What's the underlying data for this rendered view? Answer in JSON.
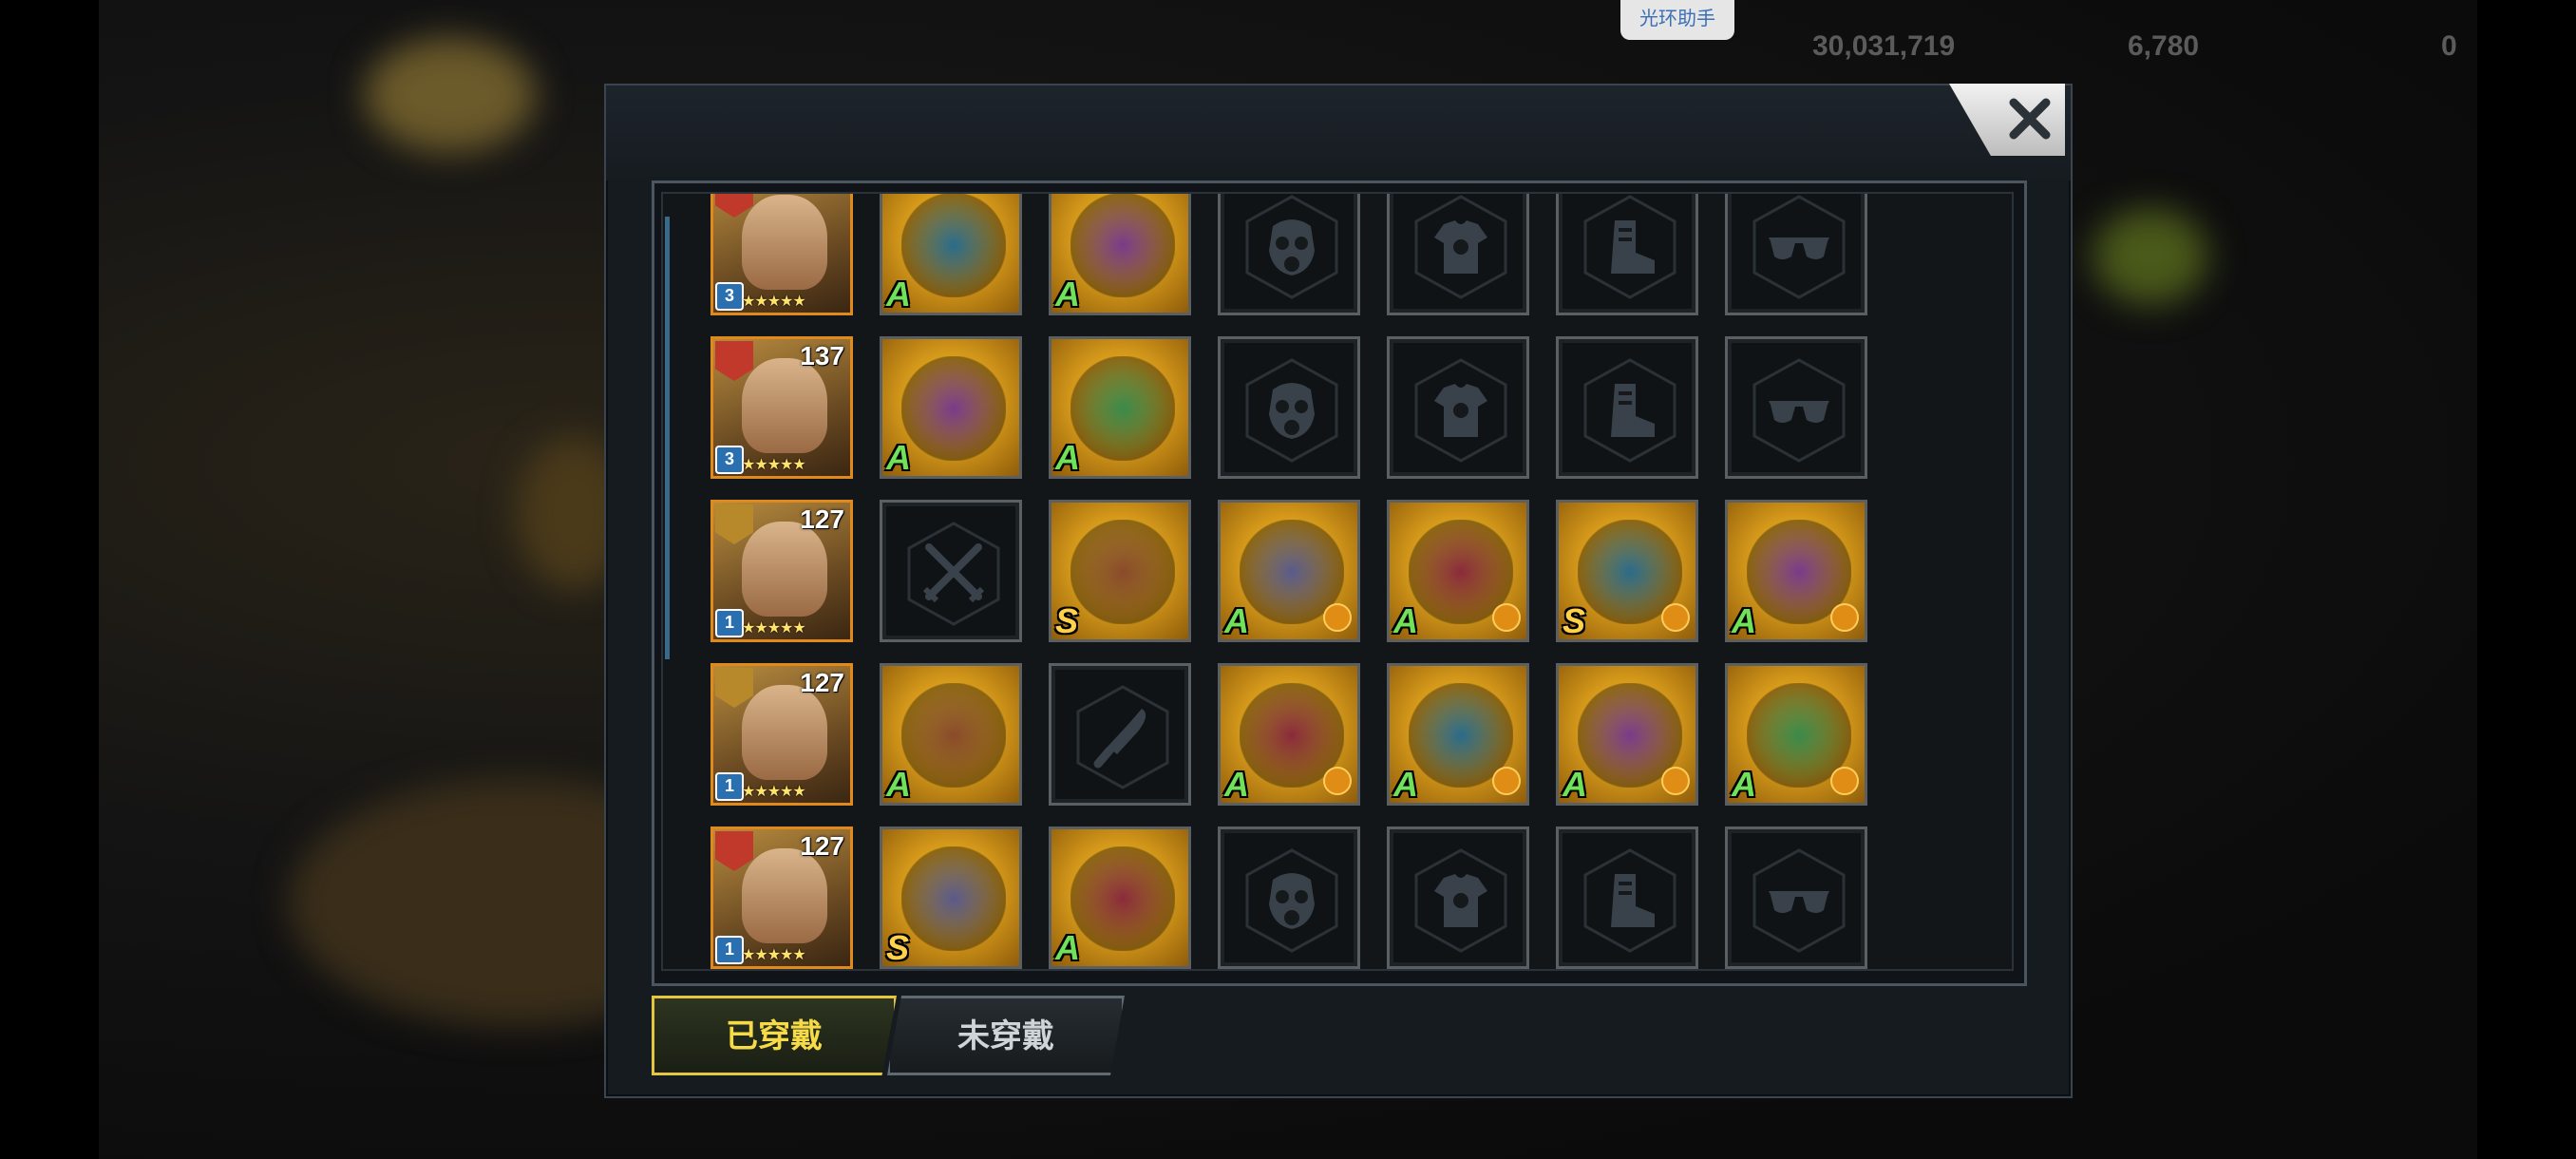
{
  "top_bar": {
    "assistant_label": "光环助手",
    "gold": "30,031,719",
    "gems": "6,780",
    "tokens": "0"
  },
  "tabs": [
    {
      "label": "已穿戴",
      "active": true
    },
    {
      "label": "未穿戴",
      "active": false
    }
  ],
  "slot_types": [
    "weapon",
    "secondary",
    "gas-mask",
    "shirt",
    "boots",
    "glasses"
  ],
  "rows": [
    {
      "level": "",
      "rank": "3",
      "stars": "★★★★★",
      "accent": "#c0392b",
      "gear": [
        {
          "state": "filled",
          "grade": "A",
          "set": false
        },
        {
          "state": "filled",
          "grade": "A",
          "set": false
        },
        {
          "state": "empty",
          "icon": "gas-mask-icon"
        },
        {
          "state": "empty",
          "icon": "shirt-icon"
        },
        {
          "state": "empty",
          "icon": "boots-icon"
        },
        {
          "state": "empty",
          "icon": "glasses-icon"
        }
      ]
    },
    {
      "level": "137",
      "rank": "3",
      "stars": "★★★★★",
      "accent": "#c0392b",
      "gear": [
        {
          "state": "filled",
          "grade": "A",
          "set": false
        },
        {
          "state": "filled",
          "grade": "A",
          "set": false
        },
        {
          "state": "empty",
          "icon": "gas-mask-icon"
        },
        {
          "state": "empty",
          "icon": "shirt-icon"
        },
        {
          "state": "empty",
          "icon": "boots-icon"
        },
        {
          "state": "empty",
          "icon": "glasses-icon"
        }
      ]
    },
    {
      "level": "127",
      "rank": "1",
      "stars": "★★★★★",
      "accent": "#b8892a",
      "gear": [
        {
          "state": "empty",
          "icon": "crossed-swords-icon"
        },
        {
          "state": "filled",
          "grade": "S",
          "set": false
        },
        {
          "state": "filled",
          "grade": "A",
          "set": true
        },
        {
          "state": "filled",
          "grade": "A",
          "set": true
        },
        {
          "state": "filled",
          "grade": "S",
          "set": true
        },
        {
          "state": "filled",
          "grade": "A",
          "set": true
        }
      ]
    },
    {
      "level": "127",
      "rank": "1",
      "stars": "★★★★★",
      "accent": "#b8892a",
      "gear": [
        {
          "state": "filled",
          "grade": "A",
          "set": false
        },
        {
          "state": "empty",
          "icon": "knife-icon"
        },
        {
          "state": "filled",
          "grade": "A",
          "set": true
        },
        {
          "state": "filled",
          "grade": "A",
          "set": true
        },
        {
          "state": "filled",
          "grade": "A",
          "set": true
        },
        {
          "state": "filled",
          "grade": "A",
          "set": true
        }
      ]
    },
    {
      "level": "127",
      "rank": "1",
      "stars": "★★★★★",
      "accent": "#c0392b",
      "gear": [
        {
          "state": "filled",
          "grade": "S",
          "set": false
        },
        {
          "state": "filled",
          "grade": "A",
          "set": false
        },
        {
          "state": "empty",
          "icon": "gas-mask-icon"
        },
        {
          "state": "empty",
          "icon": "shirt-icon"
        },
        {
          "state": "empty",
          "icon": "boots-icon"
        },
        {
          "state": "empty",
          "icon": "glasses-icon"
        }
      ]
    }
  ]
}
